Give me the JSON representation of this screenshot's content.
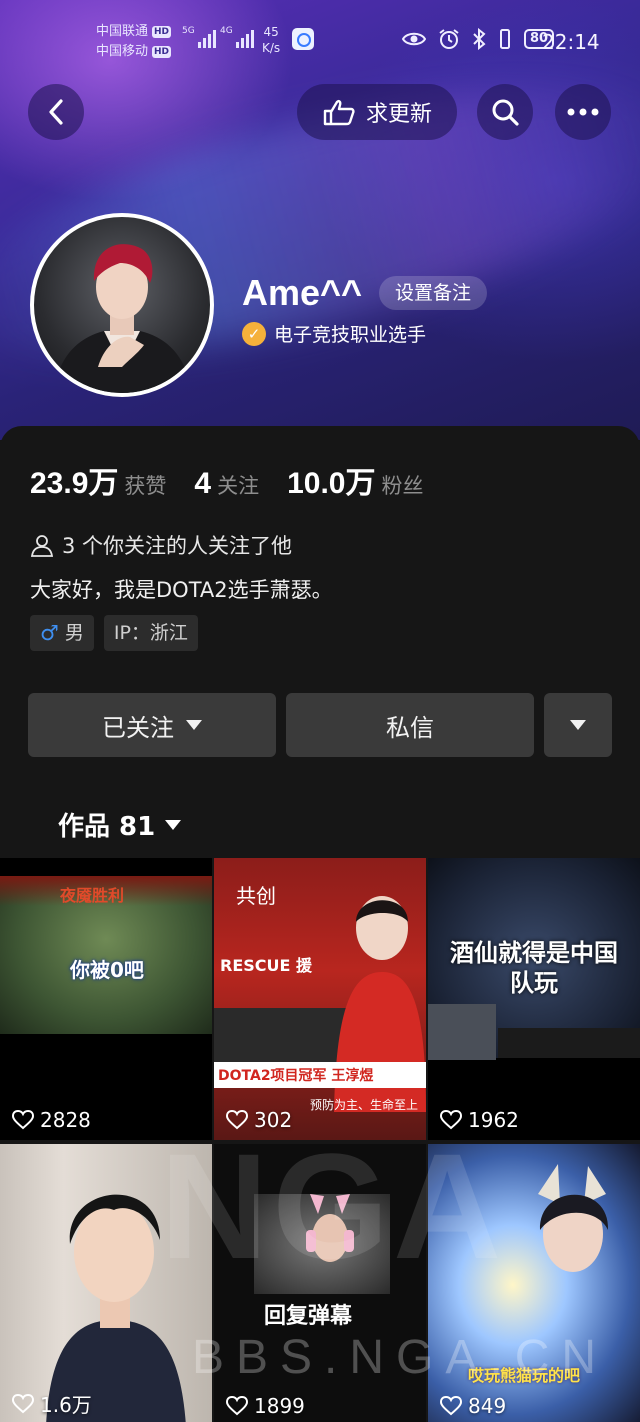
{
  "status_bar": {
    "carrier_1": "中国联通",
    "carrier_2": "中国移动",
    "hd": "HD",
    "net_5g": "5G",
    "net_4g": "4G",
    "speed_value": "45",
    "speed_unit": "K/s",
    "battery": "80",
    "time": "22:14"
  },
  "header": {
    "request_update_label": "求更新"
  },
  "profile": {
    "nickname": "Ame^^",
    "remark_label": "设置备注",
    "verified_title": "电子竞技职业选手",
    "stats": {
      "likes_value": "23.9万",
      "likes_label": "获赞",
      "following_value": "4",
      "following_label": "关注",
      "followers_value": "10.0万",
      "followers_label": "粉丝"
    },
    "mutual_text": "3 个你关注的人关注了他",
    "bio": "大家好，我是DOTA2选手萧瑟。",
    "gender_label": "男",
    "ip_label": "IP：浙江"
  },
  "actions": {
    "followed_label": "已关注",
    "message_label": "私信"
  },
  "works_tab": {
    "label": "作品 81"
  },
  "works": [
    {
      "likes": "2828",
      "overlay": "你被0吧",
      "top_text": "夜魇胜利"
    },
    {
      "likes": "302",
      "overlay": "DOTA2项目冠军 王淳煜",
      "cocreate": "共创",
      "sub": "预防为主、生命至上",
      "sign": "RESCUE 援"
    },
    {
      "likes": "1962",
      "overlay": "酒仙就得是中国队玩"
    },
    {
      "likes": "1.6万"
    },
    {
      "likes": "1899",
      "overlay": "回复弹幕"
    },
    {
      "likes": "849",
      "overlay": "哎玩熊猫玩的吧"
    }
  ],
  "watermark": {
    "text_big": "NGA",
    "text_small": "BBS.NGA.CN"
  },
  "colors": {
    "header_purple": "#3b2a9a",
    "verified_badge": "#f5b13b",
    "male_icon": "#3f8ff0",
    "panel_bg": "#161616",
    "button_bg": "#3a3a3a"
  }
}
